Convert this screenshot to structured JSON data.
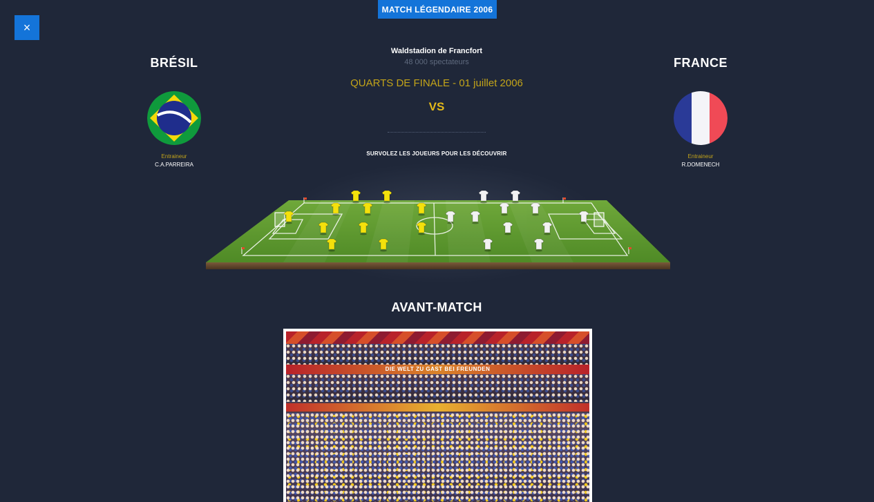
{
  "header": {
    "badge_label": "MATCH LÉGENDAIRE 2006",
    "close_label": "×"
  },
  "match": {
    "stadium": "Waldstadion de Francfort",
    "spectators": "48 000 spectateurs",
    "round": "QUARTS DE FINALE - 01 juillet 2006",
    "vs_label": "VS",
    "hover_hint": "SURVOLEZ LES JOUEURS POUR LES DÉCOUVRIR"
  },
  "home_team": {
    "name": "BRÉSIL",
    "flag_icon": "brazil-flag-icon",
    "coach_label": "Entraineur",
    "coach_name": "C.A.PARREIRA",
    "shirt_color": "#f4e10c"
  },
  "away_team": {
    "name": "FRANCE",
    "flag_icon": "france-flag-icon",
    "coach_label": "Entraineur",
    "coach_name": "R.DOMENECH",
    "shirt_color": "#f2f2f2"
  },
  "pre_match": {
    "title": "AVANT-MATCH",
    "photo_banner_text": "DIE WELT ZU GAST BEI FREUNDEN"
  },
  "colors": {
    "accent": "#1474d9",
    "gold": "#c3a419",
    "background": "#1f2739"
  }
}
